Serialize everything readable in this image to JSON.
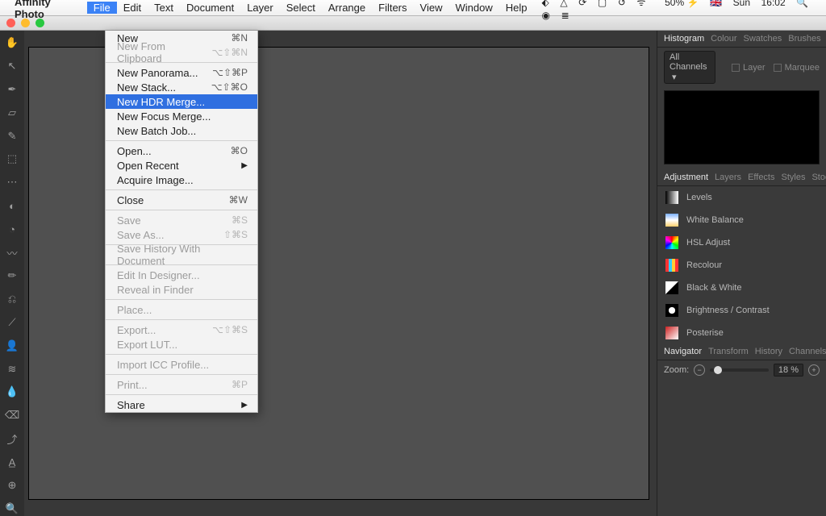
{
  "menubar": {
    "appname": "Affinity Photo",
    "items": [
      "File",
      "Edit",
      "Text",
      "Document",
      "Layer",
      "Select",
      "Arrange",
      "Filters",
      "View",
      "Window",
      "Help"
    ],
    "active": "File",
    "right": {
      "battery": "50%",
      "flag": "🇬🇧",
      "day": "Sun",
      "time": "16:02"
    }
  },
  "dropdown": [
    {
      "t": "item",
      "label": "New",
      "sc": "⌘N"
    },
    {
      "t": "item",
      "label": "New From Clipboard",
      "sc": "⌥⇧⌘N",
      "dis": true
    },
    {
      "t": "sep"
    },
    {
      "t": "item",
      "label": "New Panorama...",
      "sc": "⌥⇧⌘P"
    },
    {
      "t": "item",
      "label": "New Stack...",
      "sc": "⌥⇧⌘O"
    },
    {
      "t": "item",
      "label": "New HDR Merge...",
      "sel": true
    },
    {
      "t": "item",
      "label": "New Focus Merge..."
    },
    {
      "t": "item",
      "label": "New Batch Job..."
    },
    {
      "t": "sep"
    },
    {
      "t": "item",
      "label": "Open...",
      "sc": "⌘O"
    },
    {
      "t": "item",
      "label": "Open Recent",
      "arrow": true
    },
    {
      "t": "item",
      "label": "Acquire Image..."
    },
    {
      "t": "sep"
    },
    {
      "t": "item",
      "label": "Close",
      "sc": "⌘W"
    },
    {
      "t": "sep"
    },
    {
      "t": "item",
      "label": "Save",
      "sc": "⌘S",
      "dis": true
    },
    {
      "t": "item",
      "label": "Save As...",
      "sc": "⇧⌘S",
      "dis": true
    },
    {
      "t": "sep"
    },
    {
      "t": "item",
      "label": "Save History With Document",
      "dis": true
    },
    {
      "t": "sep"
    },
    {
      "t": "item",
      "label": "Edit In Designer...",
      "dis": true
    },
    {
      "t": "item",
      "label": "Reveal in Finder",
      "dis": true
    },
    {
      "t": "sep"
    },
    {
      "t": "item",
      "label": "Place...",
      "dis": true
    },
    {
      "t": "sep"
    },
    {
      "t": "item",
      "label": "Export...",
      "sc": "⌥⇧⌘S",
      "dis": true
    },
    {
      "t": "item",
      "label": "Export LUT...",
      "dis": true
    },
    {
      "t": "sep"
    },
    {
      "t": "item",
      "label": "Import ICC Profile...",
      "dis": true
    },
    {
      "t": "sep"
    },
    {
      "t": "item",
      "label": "Print...",
      "sc": "⌘P",
      "dis": true
    },
    {
      "t": "sep"
    },
    {
      "t": "item",
      "label": "Share",
      "arrow": true
    }
  ],
  "panel1": {
    "tabs": [
      "Histogram",
      "Colour",
      "Swatches",
      "Brushes"
    ],
    "active": "Histogram",
    "channel": "All Channels",
    "chk1": "Layer",
    "chk2": "Marquee"
  },
  "panel2": {
    "tabs": [
      "Adjustment",
      "Layers",
      "Effects",
      "Styles",
      "Stock"
    ],
    "active": "Adjustment",
    "items": [
      {
        "label": "Levels",
        "cls": "levels"
      },
      {
        "label": "White Balance",
        "cls": "wb"
      },
      {
        "label": "HSL Adjust",
        "cls": "hsl"
      },
      {
        "label": "Recolour",
        "cls": "rec"
      },
      {
        "label": "Black & White",
        "cls": "bw"
      },
      {
        "label": "Brightness / Contrast",
        "cls": "bc"
      },
      {
        "label": "Posterise",
        "cls": "post"
      }
    ]
  },
  "panel3": {
    "tabs": [
      "Navigator",
      "Transform",
      "History",
      "Channels"
    ],
    "active": "Navigator",
    "zoomLabel": "Zoom:",
    "zoomVal": "18 %"
  },
  "tools": [
    "✋",
    "↖",
    "✒",
    "▱",
    "✎",
    "⬚",
    "⋯",
    "◐",
    "◔",
    "〰",
    "✏",
    "⎌",
    "⟋",
    "👤",
    "≋",
    "💧",
    "⌫",
    "⤴",
    "A̲",
    "⊕",
    "🔍"
  ]
}
